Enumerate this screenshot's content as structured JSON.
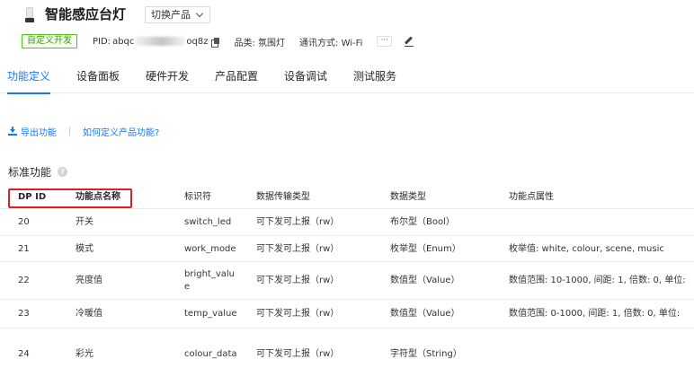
{
  "header": {
    "title": "智能感应台灯",
    "switch_label": "切换产品",
    "badge": "自定义开发",
    "pid_label": "PID:",
    "pid_prefix": "abqc",
    "pid_suffix": "oq8z",
    "category": "品类: 氛围灯",
    "protocol": "通讯方式: Wi-Fi",
    "more_label": "···"
  },
  "tabs": [
    {
      "label": "功能定义",
      "active": true
    },
    {
      "label": "设备面板"
    },
    {
      "label": "硬件开发"
    },
    {
      "label": "产品配置"
    },
    {
      "label": "设备调试"
    },
    {
      "label": "测试服务"
    }
  ],
  "actions": {
    "export_label": "导出功能",
    "help_link": "如何定义产品功能?"
  },
  "section": {
    "title": "标准功能",
    "help_glyph": "?"
  },
  "table": {
    "columns": {
      "dp_id": "DP ID",
      "name": "功能点名称",
      "identifier": "标识符",
      "transfer": "数据传输类型",
      "data_type": "数据类型",
      "attrs": "功能点属性"
    },
    "rows": [
      {
        "dp_id": "20",
        "name": "开关",
        "identifier": "switch_led",
        "transfer": "可下发可上报（rw）",
        "data_type": "布尔型（Bool）",
        "attrs": ""
      },
      {
        "dp_id": "21",
        "name": "模式",
        "identifier": "work_mode",
        "transfer": "可下发可上报（rw）",
        "data_type": "枚举型（Enum）",
        "attrs": "枚举值: white, colour, scene, music"
      },
      {
        "dp_id": "22",
        "name": "亮度值",
        "identifier": "bright_value",
        "transfer": "可下发可上报（rw）",
        "data_type": "数值型（Value）",
        "attrs": "数值范围: 10-1000, 间距: 1, 倍数: 0, 单位:"
      },
      {
        "dp_id": "23",
        "name": "冷暖值",
        "identifier": "temp_value",
        "transfer": "可下发可上报（rw）",
        "data_type": "数值型（Value）",
        "attrs": "数值范围: 0-1000, 间距: 1, 倍数: 0, 单位:"
      },
      {
        "dp_id": "24",
        "name": "彩光",
        "identifier": "colour_data",
        "transfer": "可下发可上报（rw）",
        "data_type": "字符型（String）",
        "attrs": ""
      }
    ]
  },
  "colors": {
    "accent": "#1677ff",
    "badge_green": "#389e0d",
    "highlight_red": "#e02020"
  }
}
